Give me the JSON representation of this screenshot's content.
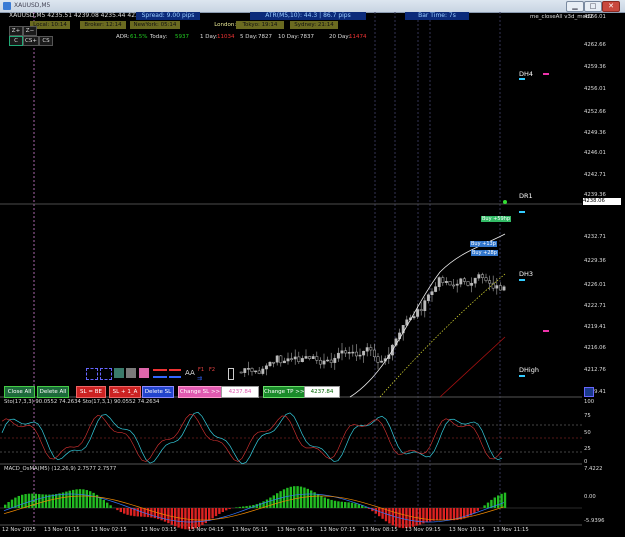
{
  "window": {
    "title": "XAUUSD,M5"
  },
  "header": {
    "ohlc": "XAUUSD,M5  4235.51 4239.08 4235.44 4238.06",
    "spread": "Spread: 9.00 pips",
    "atr": "ATR(M5,10): 44.3   |   86.7 pips",
    "bar_time": "Bar Time: 7s",
    "indicator": "me_closeAll v3d_mod2"
  },
  "sessions": {
    "local": "Local: 10:14",
    "broker": "Broker: 12:14",
    "newyork": "NewYork: 05:14",
    "london": "London: 10:14",
    "tokyo": "Tokyo: 19:14",
    "sydney": "Sydney: 21:14"
  },
  "small_buttons": {
    "zm": "Z+",
    "zp": "Z−",
    "c1": "C",
    "c2": "CS+",
    "c3": "CS"
  },
  "adr": {
    "adr_label": "ADR:",
    "adr_value": "61.5%",
    "today_label": "Today:",
    "today_value": "5937",
    "day1_label": "1 Day:",
    "day1_value": "11034",
    "day5_label": "5 Day:",
    "day5_value": "7827",
    "day10_label": "10 Day:",
    "day10_value": "7837",
    "day20_label": "20 Day:",
    "day20_value": "11474"
  },
  "price_axis": [
    "4266.01",
    "4262.66",
    "4259.36",
    "4256.01",
    "4252.66",
    "4249.36",
    "4246.01",
    "4242.71",
    "4239.36",
    "4236.06",
    "4232.71",
    "4229.36",
    "4226.01",
    "4222.71",
    "4219.41",
    "4216.06",
    "4212.76",
    "4209.41"
  ],
  "current_price": "4238.06",
  "levels": {
    "dh4": "DH4",
    "dr1": "DR1",
    "dh3": "DH3",
    "dhigh": "DHigh"
  },
  "trade_labels": {
    "buy1": "Buy +59hp",
    "buy2": "Buy +13p",
    "buy3": "Buy +28p"
  },
  "palette": {
    "labels": [
      "AA",
      "F1",
      "F2"
    ]
  },
  "buttons": {
    "close_all": "Close All",
    "delete_all": "Delete All",
    "sl_be": "SL = BE",
    "sl_plus1": "SL + 1_A",
    "delete_sl": "Delete SL",
    "change_sl": "Change SL >>",
    "sl_value": "4237.84",
    "change_tp": "Change TP >>",
    "tp_value": "4237.84"
  },
  "stoch": {
    "label": "Sto(17,3,3) 90.0552 74.2634  Sto(17,3,1) 90.0552 74.2634",
    "levels": [
      "100",
      "75",
      "50",
      "25",
      "0"
    ]
  },
  "macd": {
    "label": "MACD_OsMA(M5) (12,26,9)  2.7577  2.7577",
    "levels": [
      "7.4222",
      "0.00",
      "-5.9396"
    ]
  },
  "time_axis": [
    "12 Nov 2025",
    "13 Nov 01:15",
    "13 Nov 02:15",
    "13 Nov 03:15",
    "13 Nov 04:15",
    "13 Nov 05:15",
    "13 Nov 06:15",
    "13 Nov 07:15",
    "13 Nov 08:15",
    "13 Nov 09:15",
    "13 Nov 10:15",
    "13 Nov 11:15"
  ],
  "colors": {
    "bull": "#bbbbbb",
    "bear": "#888888",
    "macd_up": "#22bb22",
    "macd_down": "#dd2222",
    "panel_bg": "#0b2a7a"
  }
}
